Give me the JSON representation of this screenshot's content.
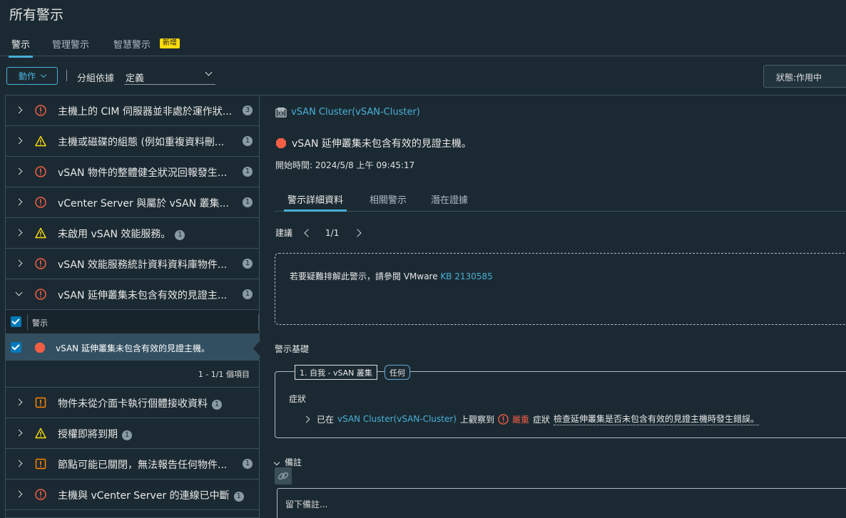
{
  "page": {
    "title": "所有警示"
  },
  "top_tabs": [
    {
      "label": "警示"
    },
    {
      "label": "管理警示"
    },
    {
      "label": "智慧警示"
    }
  ],
  "new_badge": "新增",
  "toolbar": {
    "action_label": "動作",
    "group_by_label": "分組依據",
    "group_by_value": "定義",
    "status_filter": "狀態:作用中"
  },
  "groups": [
    {
      "text": "主機上的 CIM 伺服器並非處於運作狀...",
      "count": "3",
      "severity": "critical",
      "expanded": false
    },
    {
      "text": "主機或磁碟的組態 (例如重複資料刪...",
      "count": "1",
      "severity": "warning",
      "expanded": false
    },
    {
      "text": "vSAN 物件的整體健全狀況回報發生...",
      "count": "1",
      "severity": "critical",
      "expanded": false
    },
    {
      "text": "vCenter Server 與屬於 vSAN 叢集...",
      "count": "1",
      "severity": "critical",
      "expanded": false
    },
    {
      "text": "未啟用 vSAN 效能服務。",
      "count": "1",
      "severity": "warning",
      "expanded": false
    },
    {
      "text": "vSAN 效能服務統計資料資料庫物件...",
      "count": "1",
      "severity": "critical",
      "expanded": false
    },
    {
      "text": "vSAN 延伸叢集未包含有效的見證主...",
      "count": "1",
      "severity": "critical",
      "expanded": true
    },
    {
      "text": "物件未從介面卡執行個體接收資料",
      "count": "1",
      "severity": "immediate",
      "expanded": false
    },
    {
      "text": "授權即將到期",
      "count": "1",
      "severity": "warning",
      "expanded": false
    },
    {
      "text": "節點可能已關閉，無法報告任何物件...",
      "count": "1",
      "severity": "immediate",
      "expanded": false
    },
    {
      "text": "主機與 vCenter Server 的連線已中斷",
      "count": "1",
      "severity": "critical",
      "expanded": false
    }
  ],
  "sub_table": {
    "column_label": "警示",
    "row_text": "vSAN 延伸叢集未包含有效的見證主機。",
    "footer": "1 - 1/1 個項目"
  },
  "detail": {
    "cluster_link": "vSAN Cluster(vSAN-Cluster)",
    "alarm_title": "vSAN 延伸叢集未包含有效的見證主機。",
    "start_time": "開始時間: 2024/5/8 上午 09:45:17",
    "tabs": [
      {
        "label": "警示詳細資料"
      },
      {
        "label": "相關警示"
      },
      {
        "label": "潛在證據"
      }
    ],
    "recommendation_label": "建議",
    "recommendation_page": "1/1",
    "recommendation_text": "若要疑難排解此警示，請參閱 VMware",
    "recommendation_kb": "KB 2130585",
    "basis_label": "警示基礎",
    "basis_chip": "1. 自我 - vSAN 叢集",
    "basis_any": "任何",
    "symptom_label": "症狀",
    "symptom_prefix": "已在",
    "symptom_object": "vSAN Cluster(vSAN-Cluster)",
    "symptom_observed": "上觀察到",
    "symptom_severity": "嚴重",
    "symptom_word": "症狀",
    "symptom_text": "檢查延伸叢集是否未包含有效的見證主機時發生錯誤。",
    "notes_label": "備註",
    "notes_placeholder": "留下備註..."
  },
  "colors": {
    "accent": "#49afd9",
    "critical": "#f35e44",
    "warning": "#ffdc0b",
    "immediate": "#ff8400",
    "selected_row": "#324f61",
    "background": "#1b2a32"
  }
}
